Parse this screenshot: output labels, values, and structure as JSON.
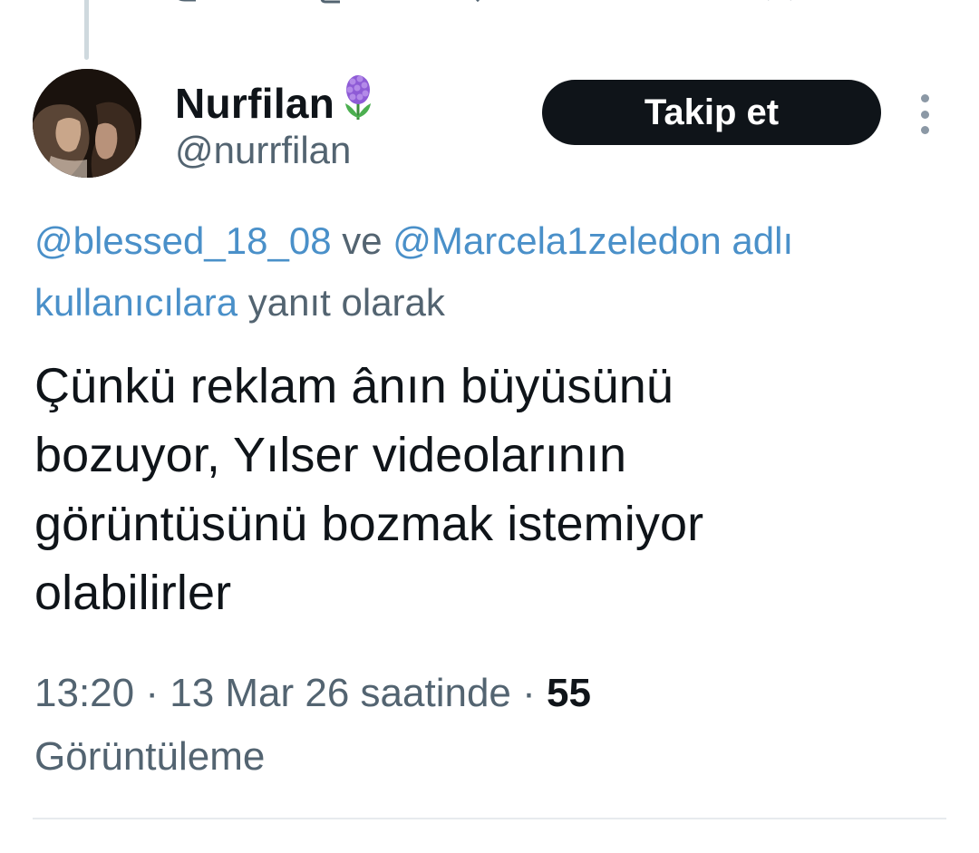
{
  "author": {
    "display_name": "Nurfilan",
    "name_emoji_icon": "hyacinth-flower-icon",
    "handle": "@nurrfilan"
  },
  "follow_label": "Takip et",
  "reply_context": {
    "mention_1": "@blessed_18_08",
    "joiner": " ve ",
    "mention_2": "@Marcela1zeledon adlı kullanıcılara",
    "suffix": " yanıt olarak"
  },
  "tweet": {
    "lines": [
      "Çünkü reklam ânın büyüsünü",
      "bozuyor, Yılser videolarının",
      "görüntüsünü bozmak istemiyor",
      "olabilirler"
    ]
  },
  "meta": {
    "time": "13:20",
    "sep1": " · ",
    "date": "13 Mar 26 saatinde",
    "sep2": " · ",
    "views_count": "55",
    "views_label": "Görüntüleme"
  },
  "colors": {
    "text": "#0f1419",
    "secondary": "#536471",
    "mention": "#4a90c9",
    "button_bg": "#0f1419",
    "button_text": "#ffffff"
  }
}
